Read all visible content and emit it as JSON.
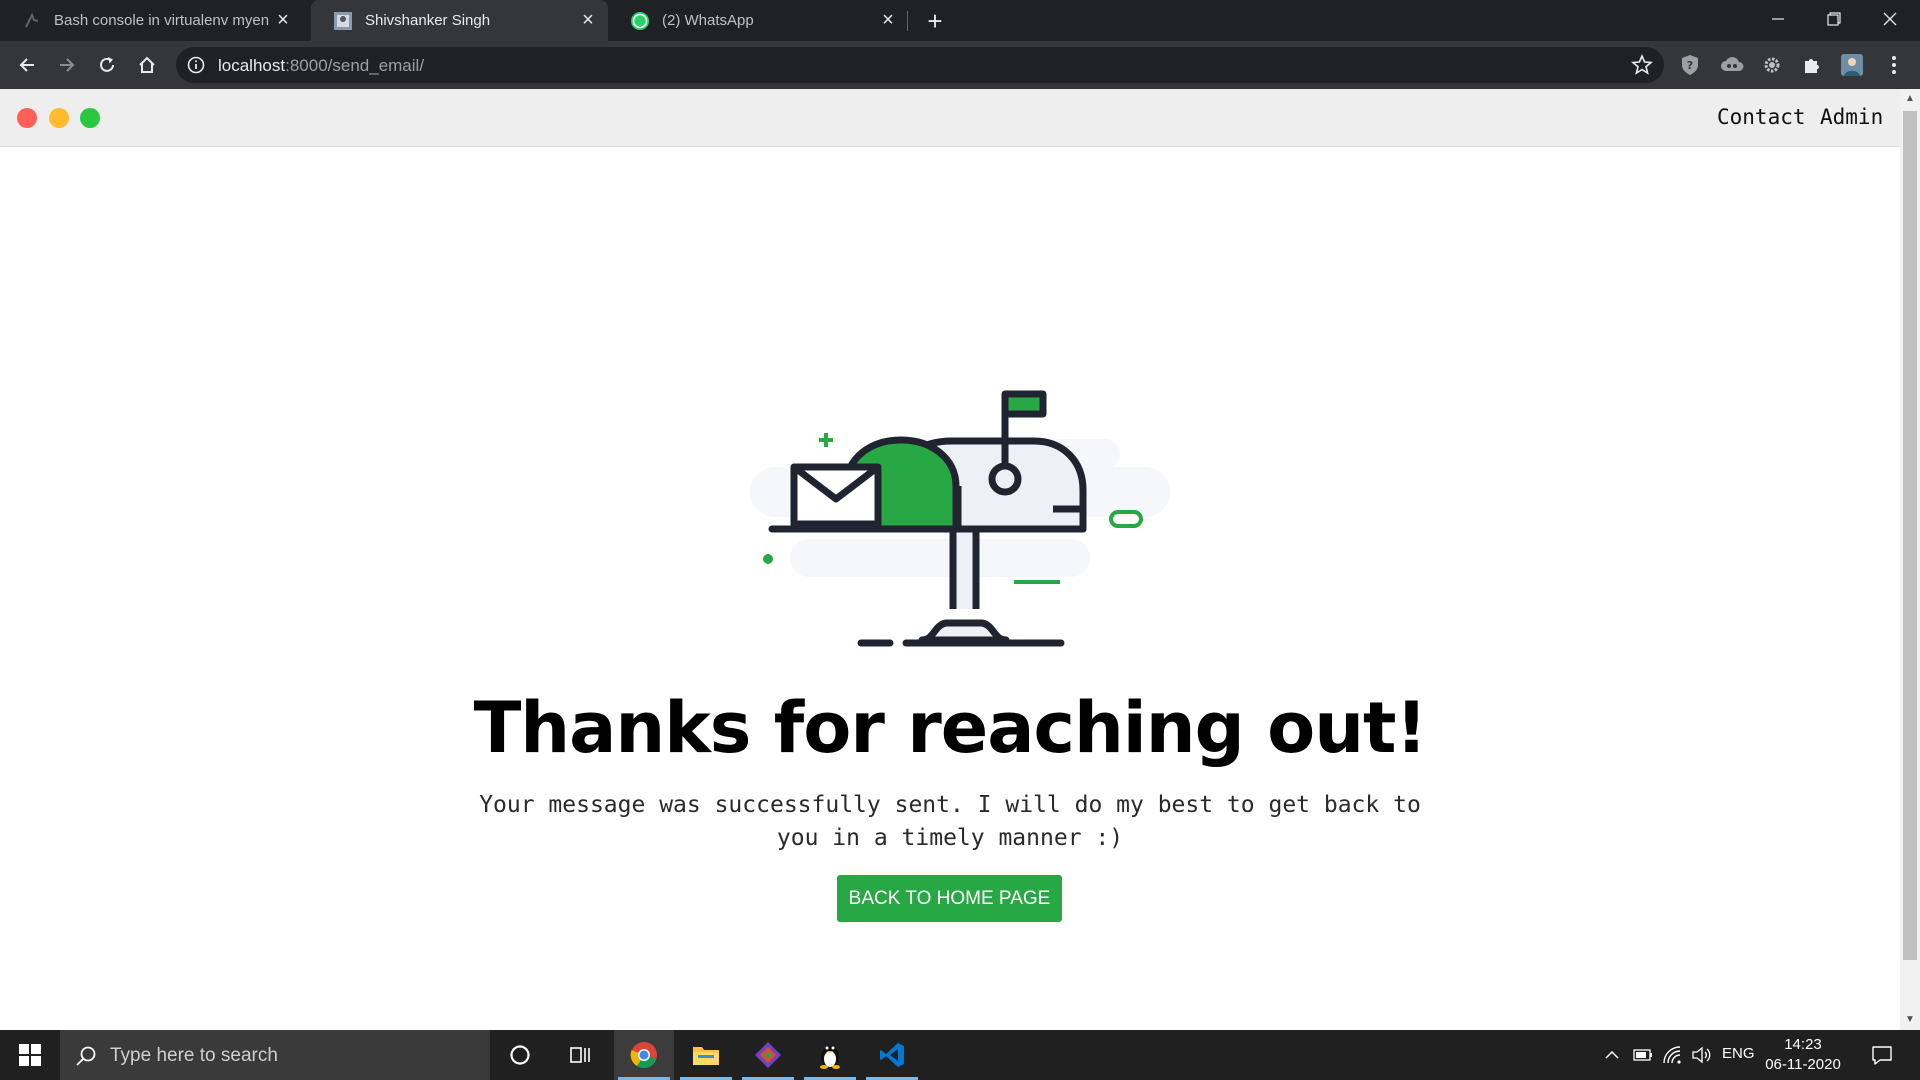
{
  "browser": {
    "tabs": [
      {
        "title": "Bash console in virtualenv myenv",
        "icon": "python-anywhere-icon",
        "active": false
      },
      {
        "title": "Shivshanker Singh",
        "icon": "site-favicon-icon",
        "active": true
      },
      {
        "title": "(2) WhatsApp",
        "icon": "whatsapp-icon",
        "active": false
      }
    ],
    "tab_close_glyph": "×",
    "new_tab_glyph": "+",
    "url_host": "localhost",
    "url_path": ":8000/send_email/"
  },
  "site": {
    "nav_links": [
      "Contact",
      "Admin"
    ],
    "headline": "Thanks for reaching out!",
    "message": "Your message was successfully sent. I will do my best to get back to you in a timely manner :)",
    "cta_label": "BACK TO HOME PAGE",
    "accent": "#28a745"
  },
  "taskbar": {
    "search_placeholder": "Type here to search",
    "language": "ENG",
    "time": "14:23",
    "date": "06-11-2020"
  }
}
